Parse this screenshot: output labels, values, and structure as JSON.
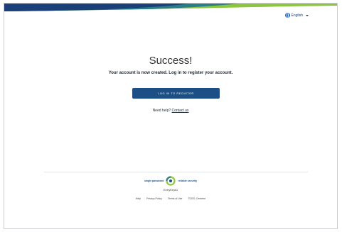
{
  "header": {
    "language_label": "English",
    "brand_colors": {
      "navy": "#1b3f78",
      "teal": "#2a7d86",
      "green": "#8cc63f"
    }
  },
  "main": {
    "title": "Success!",
    "message": "Your account is now created. Log in to register your account.",
    "login_button_label": "LOG IN TO REGISTER",
    "help_prefix": "Need help?",
    "help_link_label": "Contact us"
  },
  "footer": {
    "tagline_left": "single password",
    "tagline_right": "reliable security",
    "logo_name": "EntryKeyID",
    "links": [
      "Help",
      "Privacy Policy",
      "Terms of Use",
      "©2021 Centene"
    ]
  },
  "colors": {
    "button": "#1b4f86",
    "text": "#1f2a36"
  }
}
